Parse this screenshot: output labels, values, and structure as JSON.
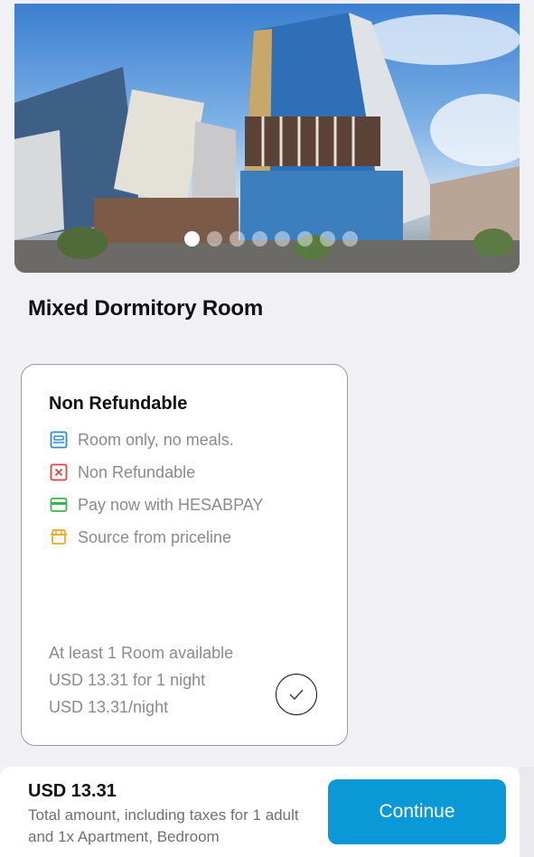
{
  "hero": {
    "image_label": "hotel-building-photo",
    "dots_total": 8,
    "dots_active_index": 0
  },
  "room": {
    "title": "Mixed Dormitory Room"
  },
  "offer": {
    "title": "Non Refundable",
    "features": [
      {
        "icon": "bed-icon",
        "color": "#2e8bd6",
        "text": "Room only, no meals."
      },
      {
        "icon": "close-box-icon",
        "color": "#e0443b",
        "text": "Non Refundable"
      },
      {
        "icon": "credit-card-icon",
        "color": "#3cb44b",
        "text": "Pay now with HESABPAY"
      },
      {
        "icon": "storefront-icon",
        "color": "#f0a61b",
        "text": "Source from priceline"
      }
    ],
    "availability": "At least 1 Room available",
    "price_total": "USD 13.31 for 1 night",
    "price_per_night": "USD 13.31/night",
    "selected": true
  },
  "footer": {
    "price": "USD 13.31",
    "total_text": "Total amount, including taxes for 1 adult and 1x Apartment,  Bedroom",
    "continue_label": "Continue",
    "accent": "#0a98d6"
  }
}
